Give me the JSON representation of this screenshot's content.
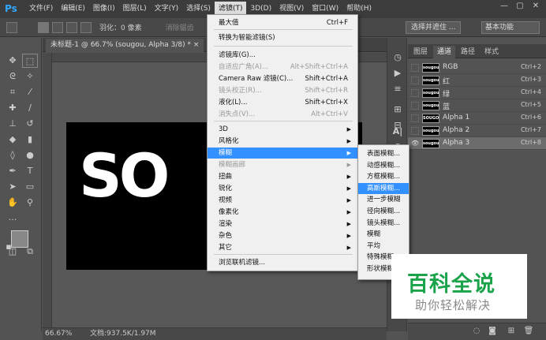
{
  "menubar": {
    "logo": "Ps",
    "items": [
      "文件(F)",
      "编辑(E)",
      "图像(I)",
      "图层(L)",
      "文字(Y)",
      "选择(S)",
      "滤镜(T)",
      "3D(D)",
      "视图(V)",
      "窗口(W)",
      "帮助(H)"
    ],
    "active_index": 6
  },
  "options": {
    "feather": "羽化：0 像素",
    "antialias": "消除锯齿",
    "select_subject": "选择并遮住 ...",
    "workspace": "基本功能"
  },
  "document": {
    "tab": "未标题-1 @ 66.7% (sougou, Alpha 3/8) *",
    "close": "×",
    "canvas_text": "SOUGOU"
  },
  "status": {
    "zoom": "66.67%",
    "docsize": "文档:937.5K/1.97M"
  },
  "channels": {
    "tabs": [
      "图层",
      "通道",
      "路径",
      "样式"
    ],
    "rows": [
      {
        "name": "RGB",
        "key": "Ctrl+2",
        "thumb": "sougou",
        "eye": false,
        "selected": false
      },
      {
        "name": "红",
        "key": "Ctrl+3",
        "thumb": "sougou",
        "eye": false,
        "selected": false
      },
      {
        "name": "绿",
        "key": "Ctrl+4",
        "thumb": "sougou",
        "eye": false,
        "selected": false
      },
      {
        "name": "蓝",
        "key": "Ctrl+5",
        "thumb": "sougou",
        "eye": false,
        "selected": false
      },
      {
        "name": "Alpha 1",
        "key": "Ctrl+6",
        "thumb": "SOUGOU",
        "eye": false,
        "selected": false
      },
      {
        "name": "Alpha 2",
        "key": "Ctrl+7",
        "thumb": "sougou",
        "eye": false,
        "selected": false
      },
      {
        "name": "Alpha 3",
        "key": "Ctrl+8",
        "thumb": "sougou",
        "eye": true,
        "selected": true
      }
    ]
  },
  "filter_menu": {
    "items": [
      {
        "label": "最大值",
        "shortcut": "Ctrl+F",
        "disabled": false
      },
      {
        "label": "转换为智能滤镜(S)",
        "shortcut": "",
        "disabled": false
      },
      {
        "label": "滤镜库(G)...",
        "shortcut": "",
        "disabled": false
      },
      {
        "label": "自适应广角(A)...",
        "shortcut": "Alt+Shift+Ctrl+A",
        "disabled": true
      },
      {
        "label": "Camera Raw 滤镜(C)...",
        "shortcut": "Shift+Ctrl+A",
        "disabled": false
      },
      {
        "label": "镜头校正(R)...",
        "shortcut": "Shift+Ctrl+R",
        "disabled": true
      },
      {
        "label": "液化(L)...",
        "shortcut": "Shift+Ctrl+X",
        "disabled": false
      },
      {
        "label": "消失点(V)...",
        "shortcut": "Alt+Ctrl+V",
        "disabled": true
      },
      {
        "label": "3D",
        "sub": true
      },
      {
        "label": "风格化",
        "sub": true
      },
      {
        "label": "模糊",
        "sub": true,
        "highlight": true
      },
      {
        "label": "模糊画廊",
        "sub": true,
        "disabled": true
      },
      {
        "label": "扭曲",
        "sub": true
      },
      {
        "label": "锐化",
        "sub": true
      },
      {
        "label": "视频",
        "sub": true
      },
      {
        "label": "像素化",
        "sub": true
      },
      {
        "label": "渲染",
        "sub": true
      },
      {
        "label": "杂色",
        "sub": true
      },
      {
        "label": "其它",
        "sub": true
      },
      {
        "label": "浏览联机滤镜..."
      }
    ]
  },
  "blur_menu": {
    "items": [
      "表面模糊...",
      "动感模糊...",
      "方框模糊...",
      "高斯模糊...",
      "进一步模糊",
      "径向模糊...",
      "镜头模糊...",
      "模糊",
      "平均",
      "特殊模糊...",
      "形状模糊..."
    ],
    "highlight_index": 3
  },
  "watermark": {
    "title": "百科全说",
    "subtitle": "助你轻松解决"
  }
}
